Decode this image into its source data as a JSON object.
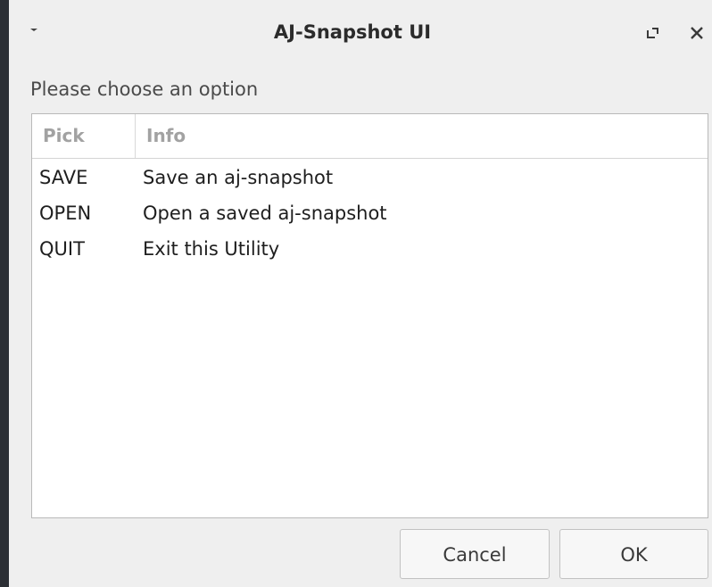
{
  "window": {
    "title": "AJ-Snapshot UI"
  },
  "dialog": {
    "prompt": "Please choose an option",
    "columns": [
      "Pick",
      "Info"
    ],
    "rows": [
      {
        "pick": "SAVE",
        "info": "Save an aj-snapshot"
      },
      {
        "pick": "OPEN",
        "info": "Open a saved aj-snapshot"
      },
      {
        "pick": "QUIT",
        "info": "Exit this Utility"
      }
    ]
  },
  "buttons": {
    "cancel_label": "Cancel",
    "ok_label": "OK"
  },
  "icons": {
    "window_menu": "chevron-down-icon",
    "maximize": "maximize-icon",
    "close": "close-icon"
  }
}
